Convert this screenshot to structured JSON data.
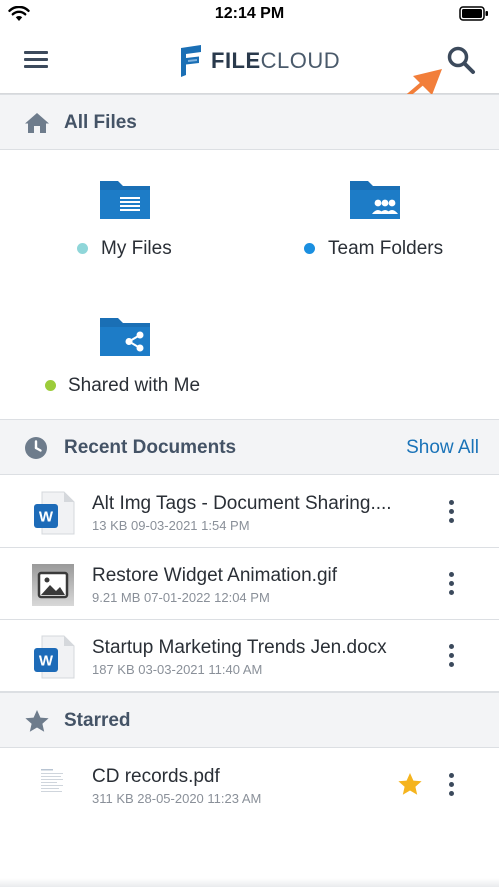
{
  "status_bar": {
    "time": "12:14 PM",
    "wifi_icon": "wifi-icon",
    "battery_icon": "battery-icon"
  },
  "header": {
    "menu_icon": "hamburger-menu-icon",
    "logo_text_bold": "FILE",
    "logo_text_rest": "CLOUD",
    "search_icon": "search-icon"
  },
  "all_files": {
    "title": "All Files",
    "icon": "home-icon",
    "folders": [
      {
        "label": "My Files",
        "dot_color": "#8fd6d9",
        "icon": "folder-document-icon"
      },
      {
        "label": "Team Folders",
        "dot_color": "#1a8fe0",
        "icon": "folder-people-icon"
      },
      {
        "label": "Shared with Me",
        "dot_color": "#9ccc3a",
        "icon": "folder-share-icon"
      }
    ]
  },
  "recent": {
    "title": "Recent Documents",
    "icon": "clock-icon",
    "show_all_label": "Show All",
    "items": [
      {
        "name": "Alt Img Tags - Document Sharing....",
        "meta": "13 KB 09-03-2021 1:54 PM",
        "type": "word-doc-icon"
      },
      {
        "name": "Restore Widget Animation.gif",
        "meta": "9.21 MB 07-01-2022 12:04 PM",
        "type": "image-file-icon"
      },
      {
        "name": "Startup Marketing Trends Jen.docx",
        "meta": "187 KB 03-03-2021 11:40 AM",
        "type": "word-doc-icon"
      }
    ]
  },
  "starred": {
    "title": "Starred",
    "icon": "star-outline-icon",
    "items": [
      {
        "name": "CD records.pdf",
        "meta": "311 KB 28-05-2020 11:23 AM",
        "type": "pdf-thumbnail-icon",
        "starred": true
      }
    ]
  },
  "colors": {
    "brand_blue": "#1a6fb5",
    "accent_orange": "#f27e3a",
    "star_gold": "#f5b41e",
    "section_bg": "#f3f4f6"
  }
}
